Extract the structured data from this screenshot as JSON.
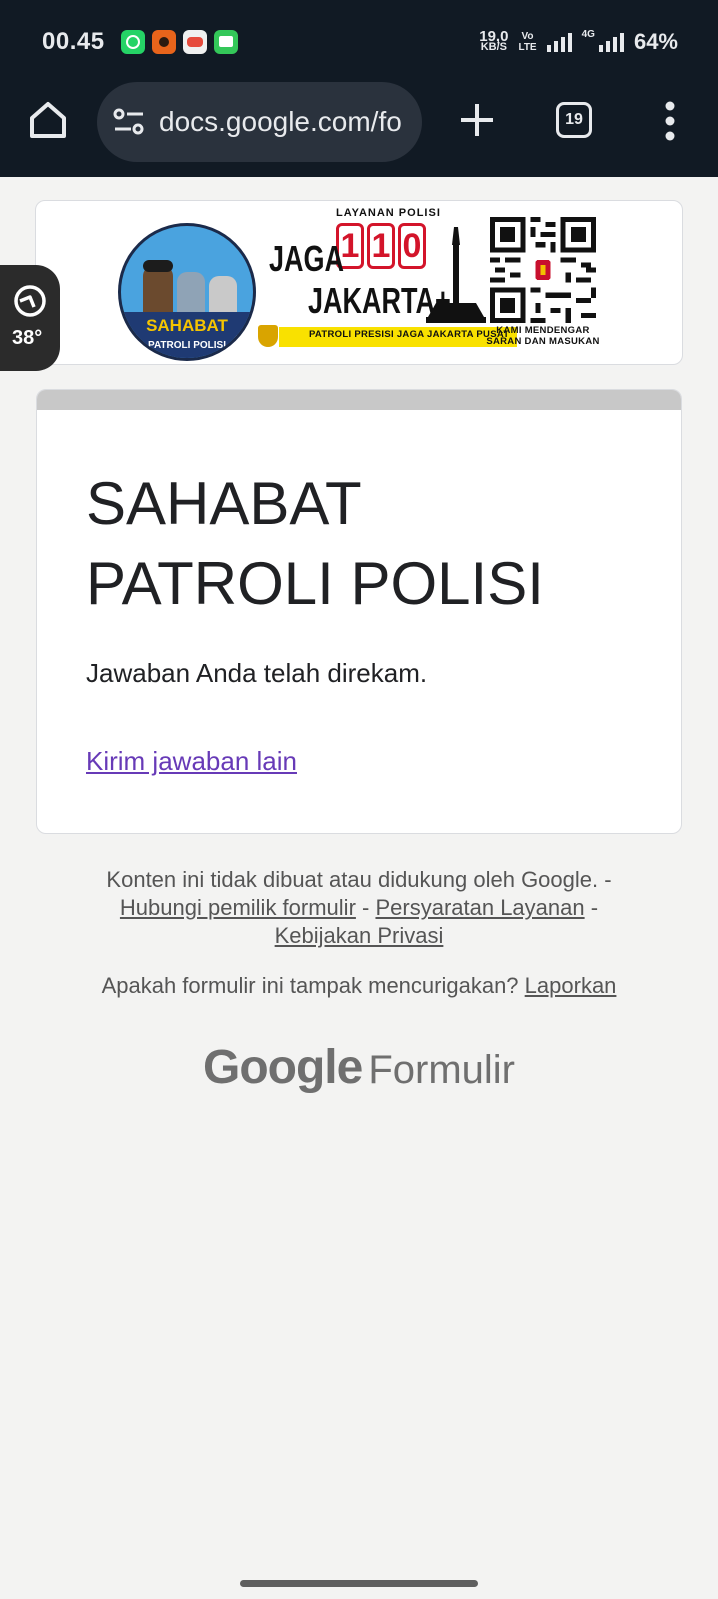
{
  "status_bar": {
    "time": "00.45",
    "notification_icons": [
      "whatsapp-icon",
      "fox-app-icon",
      "game-app-icon",
      "messages-icon"
    ],
    "net_speed_value": "19,0",
    "net_speed_unit": "KB/S",
    "volte_line1": "Vo",
    "volte_line2": "LTE",
    "network_type": "4G",
    "battery": "64%"
  },
  "browser": {
    "url": "docs.google.com/fo",
    "tab_count": "19"
  },
  "banner": {
    "emblem_line1": "SAHABAT",
    "emblem_line2": "PATROLI POLISI",
    "service_label": "LAYANAN POLISI",
    "hotline": [
      "1",
      "1",
      "0"
    ],
    "title_line1": "JAGA",
    "title_line2": "JAKARTA+",
    "motto": "PATROLI PRESISI JAGA JAKARTA PUSAT",
    "qr_caption_line1": "KAMI MENDENGAR",
    "qr_caption_line2": "SARAN DAN MASUKAN"
  },
  "speed_overlay": {
    "value": "38°"
  },
  "form": {
    "title": "SAHABAT PATROLI POLISI",
    "message": "Jawaban Anda telah direkam.",
    "link_label": "Kirim jawaban lain"
  },
  "footer": {
    "disclaimer": "Konten ini tidak dibuat atau didukung oleh Google.",
    "contact_link": "Hubungi pemilik formulir",
    "terms_link": "Persyaratan Layanan",
    "privacy_link": "Kebijakan Privasi",
    "report_question": "Apakah formulir ini tampak mencurigakan?",
    "report_link": "Laporkan",
    "brand_google": "Google",
    "brand_product": "Formulir"
  },
  "colors": {
    "chrome_bg": "#111a24",
    "page_bg": "#f3f3f2",
    "link_purple": "#673ab7",
    "card_header": "#c8c8c8"
  }
}
